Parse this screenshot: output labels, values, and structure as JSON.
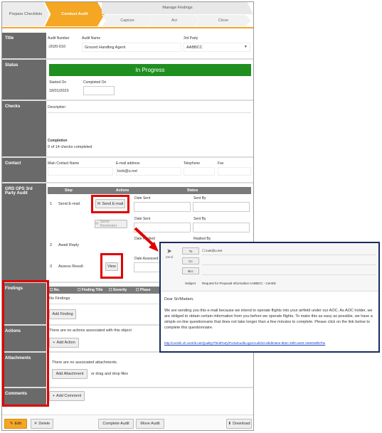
{
  "stepper": {
    "prepare": "Prepare Checklists",
    "conduct": "Conduct Audit",
    "manage": "Manage Findings",
    "capture": "Capture",
    "act": "Act",
    "close": "Close"
  },
  "title_section": {
    "label": "Title",
    "audit_number_label": "Audit Number",
    "audit_number": "-2020-010",
    "audit_name_label": "Audit Name",
    "audit_name": "Ground Handling Agent",
    "third_party_label": "3rd Party",
    "third_party": "AABBCC"
  },
  "status_section": {
    "label": "Status",
    "status": "In Progress",
    "started_on_label": "Started On",
    "started_on": "18/01/2023",
    "completed_on_label": "Completed On"
  },
  "checks_section": {
    "label": "Checks",
    "description_label": "Description",
    "completion_label": "Completion",
    "completion_text": "0 of 14 checks completed"
  },
  "contact_section": {
    "label": "Contact",
    "main_contact_label": "Main Contact Name",
    "email_label": "E-mail address",
    "email": "look@u.net",
    "telephone_label": "Telephone",
    "fax_label": "Fax"
  },
  "grd_section": {
    "label": "GRD OPS 3rd Party Audit",
    "col_step": "Step",
    "col_actions": "Actions",
    "col_status": "Status",
    "row1_num": "1",
    "row1_step": "Send E-mail",
    "send_email_btn": "Send E-mail",
    "send_reminder_btn": "Send Reminder",
    "date_sent": "Date Sent",
    "sent_by": "Sent By",
    "date_sent2": "Date Sent",
    "sent_by2": "Sent By",
    "date_replied": "Date Replied",
    "replied_by": "Replied By",
    "row2_num": "2",
    "row2_step": "Await Reply",
    "row3_num": "3",
    "row3_step": "Assess Result",
    "view_btn": "View",
    "date_assessed": "Date Assessed"
  },
  "findings_section": {
    "label": "Findings",
    "col_no": "No.",
    "col_title": "Finding Title",
    "col_severity": "Severity",
    "col_phase": "Phase",
    "no_findings": "No Findings",
    "add_finding": "Add Finding"
  },
  "actions_section": {
    "label": "Actions",
    "empty": "There are no actions associated with this object",
    "add_action": "Add Action"
  },
  "attachments_section": {
    "label": "Attachments",
    "empty": "There are no associated attachments.",
    "add_attachment": "Add Attachment",
    "drag_text": "or drag and drop files"
  },
  "comments_section": {
    "label": "Comments",
    "add_comment": "Add Comment"
  },
  "footer": {
    "edit": "Edit",
    "delete": "Delete",
    "complete_audit": "Complete Audit",
    "move_audit": "Move Audit",
    "download": "Download"
  },
  "email": {
    "send_label": "Send",
    "to_btn": "To",
    "cc_btn": "Cc",
    "bcc_btn": "Bcc",
    "to_value": "look@u.net",
    "subject_label": "Subject",
    "subject_value": "Request for Proposal Information AABBCC - Centrik",
    "greeting": "Dear Sir/Madam,",
    "body": "We are sending you this e-mail because we intend to operate flights into your airfield under our AOC. As AOC holder, we are obliged to obtain certain information from you before we operate flights. To make this as easy as possible, we have a simple on-line questionnaire that does not take longer than a few minutes to complete. Please click on the link below to complete this questionnaire.",
    "link": "http://centrik.xh.centrik.net/Quality/ThirdParty/PortalAuditLogin/Audit/Id=8bdb49ee-8b0c-49f0-a483-c9e5038f57be"
  },
  "colors": {
    "accent": "#f5a623",
    "label_bg": "#6a6a6a",
    "status_green": "#1f8f1f",
    "highlight_red": "#e00000",
    "email_border": "#1c2b5e"
  }
}
